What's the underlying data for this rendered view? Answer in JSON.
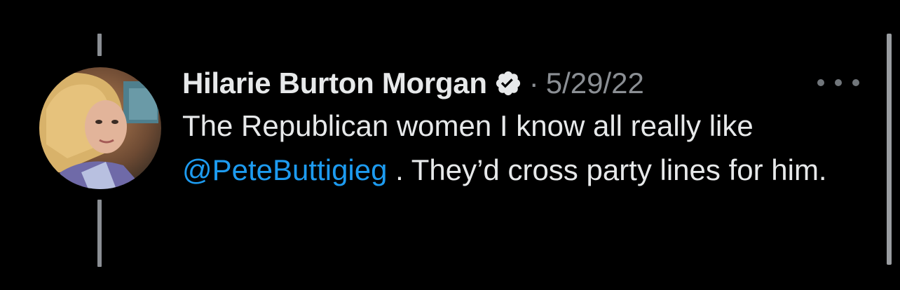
{
  "tweet": {
    "author": {
      "display_name": "Hilarie Burton Morgan",
      "verified_icon": "verified-badge-icon",
      "avatar_icon": "profile-photo"
    },
    "separator": "·",
    "timestamp": "5/29/22",
    "more_icon": "ellipsis-icon",
    "text": {
      "part1": "The Republican women I know all really like ",
      "mention": "@PeteButtigieg",
      "part2": " . They’d cross party lines for him."
    }
  },
  "colors": {
    "background": "#000000",
    "text": "#e7e9ea",
    "muted": "#8b8f94",
    "mention": "#1d9bf0"
  }
}
